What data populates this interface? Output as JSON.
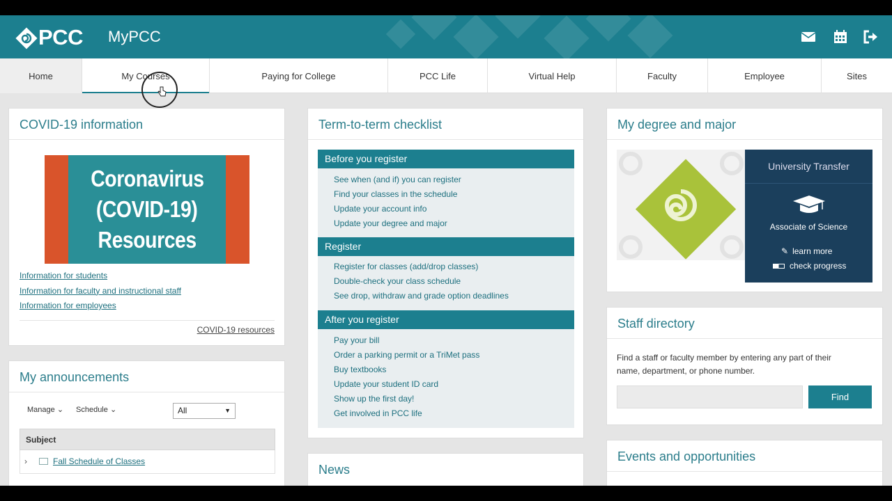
{
  "header": {
    "brand": "PCC",
    "app_title": "MyPCC",
    "icons": [
      "mail-icon",
      "calendar-icon",
      "sign-out-icon"
    ],
    "brand_color": "#1c7f8f"
  },
  "nav": {
    "tabs": [
      {
        "label": "Home"
      },
      {
        "label": "My Courses"
      },
      {
        "label": "Paying for College"
      },
      {
        "label": "PCC Life"
      },
      {
        "label": "Virtual Help"
      },
      {
        "label": "Faculty"
      },
      {
        "label": "Employee"
      },
      {
        "label": "Sites"
      }
    ]
  },
  "covid": {
    "title": "COVID-19 information",
    "image_lines": [
      "Coronavirus",
      "(COVID-19)",
      "Resources"
    ],
    "links": [
      "Information for students",
      "Information for faculty and instructional staff",
      "Information for employees"
    ],
    "resources_link": "COVID-19 resources"
  },
  "announcements": {
    "title": "My announcements",
    "manage_label": "Manage",
    "schedule_label": "Schedule",
    "filter_value": "All",
    "table_header": "Subject",
    "rows": [
      "Fall Schedule of Classes"
    ]
  },
  "checklist": {
    "title": "Term-to-term checklist",
    "sections": [
      {
        "heading": "Before you register",
        "items": [
          "See when (and if) you can register",
          "Find your classes in the schedule",
          "Update your account info",
          "Update your degree and major"
        ]
      },
      {
        "heading": "Register",
        "items": [
          "Register for classes (add/drop classes)",
          "Double-check your class schedule",
          "See drop, withdraw and grade option deadlines"
        ]
      },
      {
        "heading": "After you register",
        "items": [
          "Pay your bill",
          "Order a parking permit or a TriMet pass",
          "Buy textbooks",
          "Update your student ID card",
          "Show up the first day!",
          "Get involved in PCC life"
        ]
      }
    ]
  },
  "news": {
    "title": "News"
  },
  "degree": {
    "title": "My degree and major",
    "program": "University Transfer",
    "degree_name": "Associate of Science",
    "learn_more": "learn more",
    "check_progress": "check progress"
  },
  "staff": {
    "title": "Staff directory",
    "description": "Find a staff or faculty member by entering any part of their name, department, or phone number.",
    "find_label": "Find"
  },
  "events": {
    "title": "Events and opportunities"
  }
}
